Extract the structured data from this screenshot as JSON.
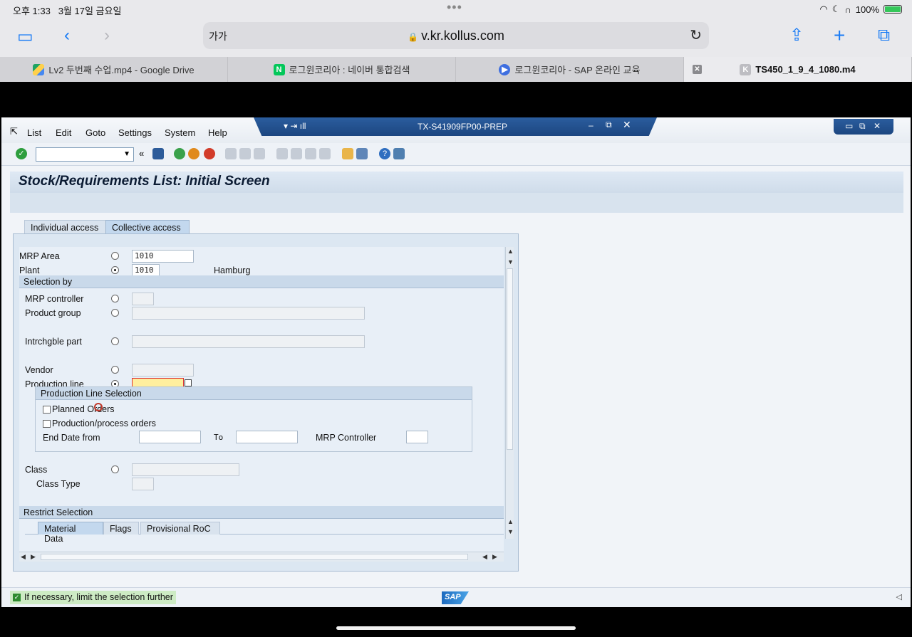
{
  "status_bar": {
    "time": "오후 1:33",
    "date": "3월 17일 금요일",
    "battery": "100%"
  },
  "browser": {
    "text_size_label": "가가",
    "url": "v.kr.kollus.com",
    "tabs": [
      {
        "label": "Lv2 두번째 수업.mp4 - Google Drive"
      },
      {
        "label": "로그윈코리아 : 네이버 통합검색",
        "favicon": "N"
      },
      {
        "label": "로그윈코리아 - SAP 온라인 교육"
      },
      {
        "label": "TS450_1_9_4_1080.m4",
        "favicon": "K"
      }
    ]
  },
  "sap": {
    "menu": [
      "List",
      "Edit",
      "Goto",
      "Settings",
      "System",
      "Help"
    ],
    "system_title": "TX-S41909FP00-PREP",
    "screen_title": "Stock/Requirements List: Initial Screen",
    "tabs": [
      "Individual access",
      "Collective access"
    ],
    "form": {
      "mrp_area_label": "MRP Area",
      "mrp_area_value": "1010",
      "plant_label": "Plant",
      "plant_value": "1010",
      "plant_name": "Hamburg",
      "selection_by": "Selection by",
      "mrp_controller_label": "MRP controller",
      "product_group_label": "Product group",
      "intrchgble_part_label": "Intrchgble part",
      "vendor_label": "Vendor",
      "production_line_label": "Production line",
      "production_line_selection": "Production Line Selection",
      "planned_orders_label": "Planned Orders",
      "production_orders_label": "Production/process orders",
      "end_date_from_label": "End Date from",
      "to_label": "To",
      "mrp_controller_label2": "MRP Controller",
      "class_label": "Class",
      "class_type_label": "Class Type",
      "restrict_selection": "Restrict Selection",
      "sub_tabs": [
        "Material Data",
        "Flags",
        "Provisional RoC"
      ]
    },
    "status_message": "If necessary, limit the selection further",
    "logo_text": "SAP"
  }
}
